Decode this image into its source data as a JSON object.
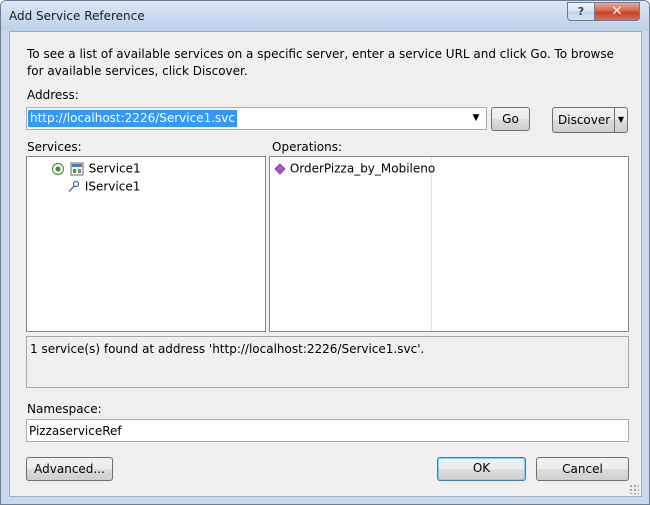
{
  "window": {
    "title": "Add Service Reference",
    "help_label": "?",
    "close_label": "✕"
  },
  "instructions": "To see a list of available services on a specific server, enter a service URL and click Go. To browse for available services, click Discover.",
  "address": {
    "label": "Address:",
    "value": "http://localhost:2226/Service1.svc",
    "dropdown_glyph": "▼",
    "go_label": "Go",
    "discover_label": "Discover",
    "discover_arrow": "▼"
  },
  "services": {
    "label": "Services:",
    "items": [
      {
        "label": "Service1",
        "icon": "service-icon"
      },
      {
        "label": "IService1",
        "icon": "interface-icon"
      }
    ]
  },
  "operations": {
    "label": "Operations:",
    "items": [
      {
        "label": "OrderPizza_by_Mobileno",
        "icon": "method-icon"
      }
    ]
  },
  "status": "1 service(s) found at address 'http://localhost:2226/Service1.svc'.",
  "namespace": {
    "label": "Namespace:",
    "value": "PizzaserviceRef"
  },
  "buttons": {
    "advanced": "Advanced...",
    "ok": "OK",
    "cancel": "Cancel"
  },
  "colors": {
    "selection": "#3399ff",
    "titlebar": "#c9d9ee",
    "close_button": "#c8402a",
    "dialog_background": "#f0f0f0"
  }
}
